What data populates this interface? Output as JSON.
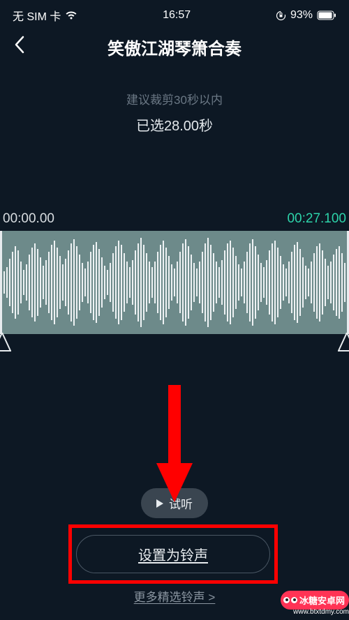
{
  "status_bar": {
    "sim": "无 SIM 卡",
    "time": "16:57",
    "battery_percent": "93%"
  },
  "header": {
    "title": "笑傲江湖琴箫合奏"
  },
  "editor": {
    "hint": "建议裁剪30秒以内",
    "selected_label": "已选28.00秒",
    "time_start": "00:00.00",
    "time_end": "00:27.100"
  },
  "actions": {
    "preview_label": "试听",
    "set_ringtone_label": "设置为铃声",
    "more_ringtones_label": "更多精选铃声 >"
  },
  "watermark": {
    "brand": "冰糖安卓网",
    "url": "www.btxtdmy.com"
  }
}
